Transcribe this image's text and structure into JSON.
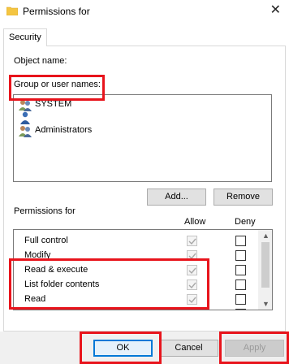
{
  "window": {
    "title": "Permissions for",
    "close_label": "✕"
  },
  "tabs": [
    {
      "label": "Security"
    }
  ],
  "object_name_label": "Object name:",
  "group_label": "Group or user names:",
  "users": [
    {
      "name": "SYSTEM",
      "icon": "group-users-icon"
    },
    {
      "name": "",
      "icon": "user-icon"
    },
    {
      "name": "Administrators",
      "icon": "group-users-icon"
    }
  ],
  "buttons": {
    "add": "Add...",
    "remove": "Remove"
  },
  "permissions_label": "Permissions for",
  "columns": {
    "allow": "Allow",
    "deny": "Deny"
  },
  "permissions": [
    {
      "name": "Full control",
      "allow": true,
      "deny": false
    },
    {
      "name": "Modify",
      "allow": true,
      "deny": false
    },
    {
      "name": "Read & execute",
      "allow": true,
      "deny": false
    },
    {
      "name": "List folder contents",
      "allow": true,
      "deny": false
    },
    {
      "name": "Read",
      "allow": true,
      "deny": false
    },
    {
      "name": "",
      "allow": true,
      "deny": false
    }
  ],
  "footer": {
    "ok": "OK",
    "cancel": "Cancel",
    "apply": "Apply"
  },
  "colors": {
    "highlight": "#e8141c",
    "focus": "#0078d7"
  }
}
